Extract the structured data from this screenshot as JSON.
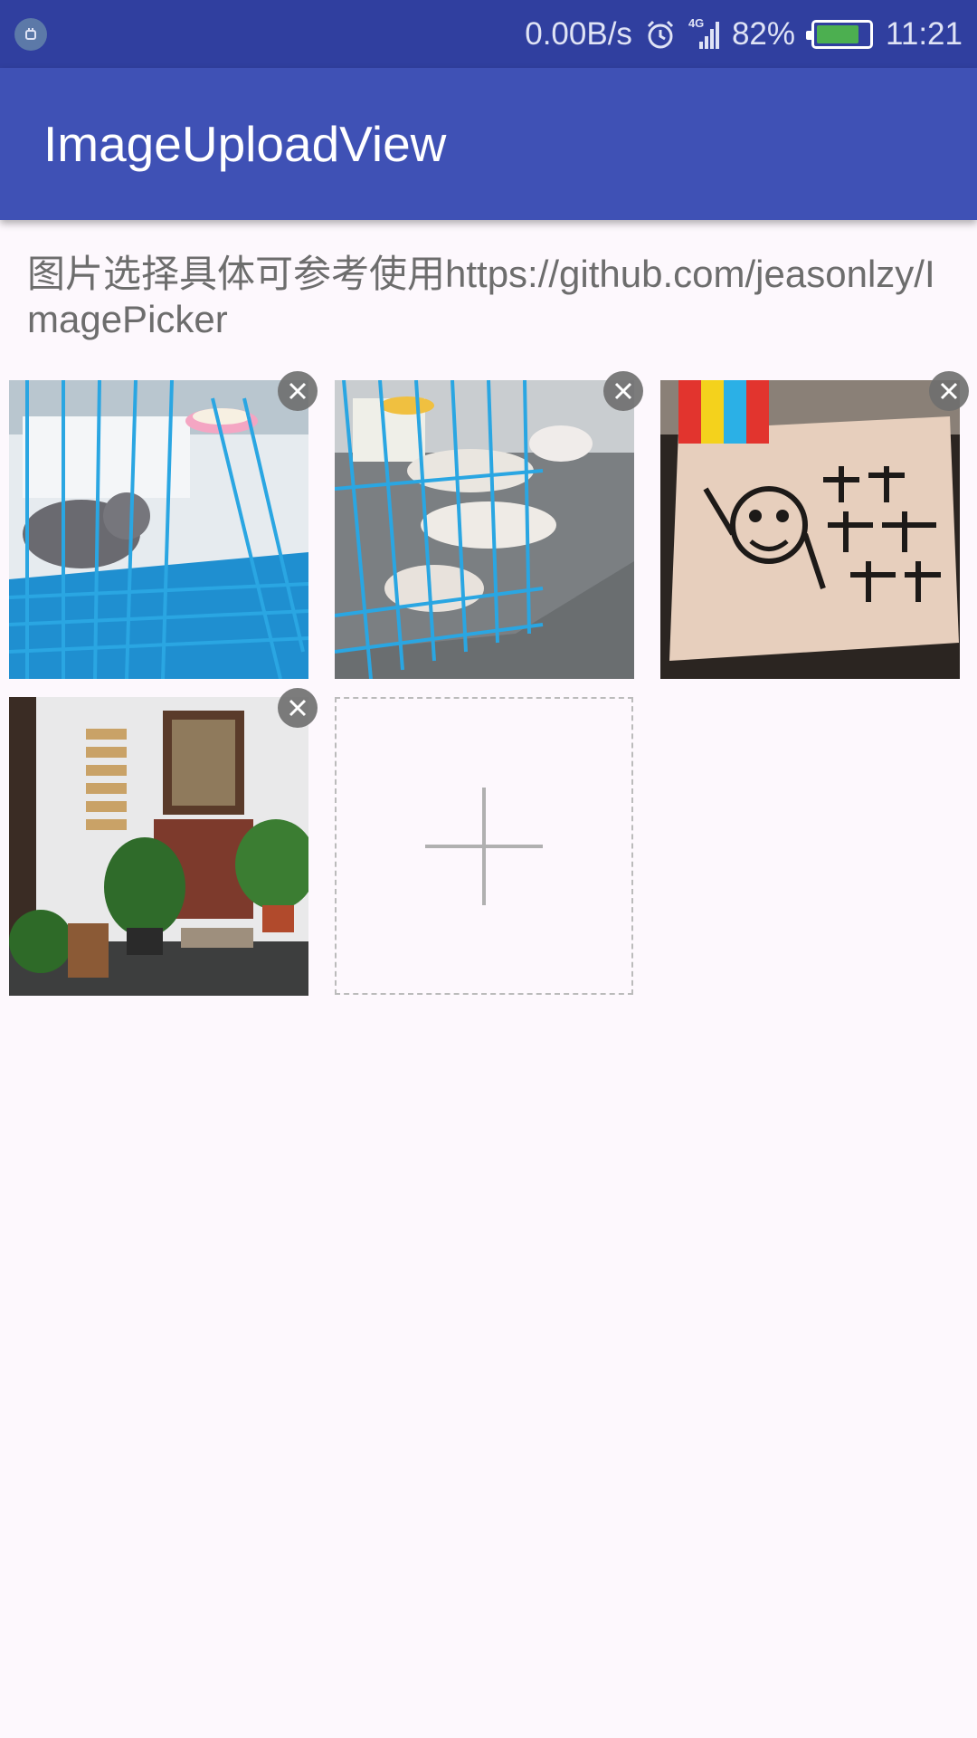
{
  "status_bar": {
    "net_speed": "0.00B/s",
    "network_type": "4G",
    "battery_percent": "82%",
    "battery_level": 0.82,
    "time": "11:21",
    "icons": [
      "notification-icon",
      "alarm-icon",
      "signal-icon",
      "battery-icon"
    ]
  },
  "app_bar": {
    "title": "ImageUploadView"
  },
  "main": {
    "description": "图片选择具体可参考使用https://github.com/jeasonlzy/ImagePicker"
  },
  "images": [
    {
      "name": "kitten-cage-photo"
    },
    {
      "name": "cats-in-cage-photo"
    },
    {
      "name": "sign-board-photo"
    },
    {
      "name": "window-plants-photo"
    }
  ],
  "add_tile": {
    "icon": "plus-icon"
  },
  "colors": {
    "status_bar": "#303f9f",
    "app_bar": "#3f51b5",
    "background": "#fdf8fd",
    "description_text": "#6d6d6d"
  }
}
